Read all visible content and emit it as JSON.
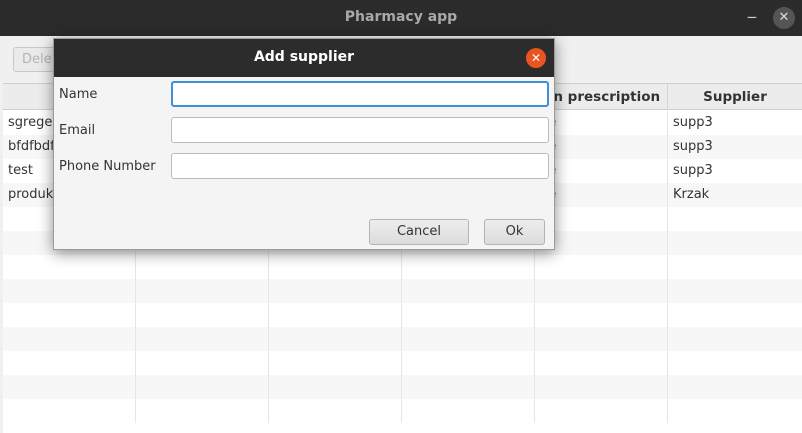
{
  "window": {
    "title": "Pharmacy app",
    "minimize_glyph": "‒",
    "close_glyph": "✕"
  },
  "toolbar": {
    "delete_label": "Dele"
  },
  "table": {
    "columns": [
      "N",
      "",
      "",
      "",
      "On prescription",
      "Supplier"
    ],
    "rows": [
      [
        "sgrege",
        "",
        "",
        "",
        "ue",
        "supp3"
      ],
      [
        "bfdfbdf",
        "",
        "",
        "",
        "ue",
        "supp3"
      ],
      [
        "test",
        "",
        "",
        "",
        "ue",
        "supp3"
      ],
      [
        "produk",
        "",
        "",
        "",
        "ue",
        "Krzak"
      ]
    ]
  },
  "dialog": {
    "title": "Add supplier",
    "close_glyph": "✕",
    "fields": [
      {
        "label": "Name",
        "value": "",
        "placeholder": ""
      },
      {
        "label": "Email",
        "value": "",
        "placeholder": ""
      },
      {
        "label": "Phone Number",
        "value": "",
        "placeholder": ""
      }
    ],
    "cancel_label": "Cancel",
    "ok_label": "Ok"
  },
  "colors": {
    "accent_focus": "#3d8fd6",
    "close_button": "#e95420",
    "titlebar": "#2b2b2b"
  }
}
